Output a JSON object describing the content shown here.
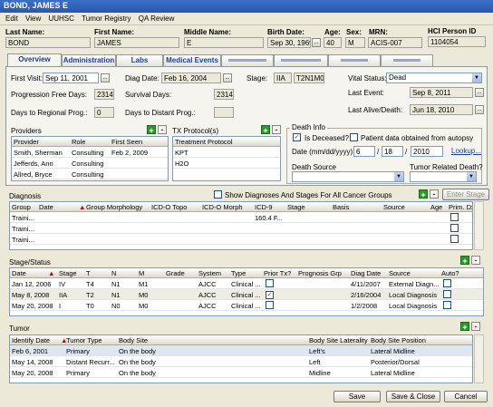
{
  "window": {
    "title": "BOND, JAMES E"
  },
  "menu": [
    "Edit",
    "View",
    "UUHSC",
    "Tumor Registry",
    "QA Review"
  ],
  "header": {
    "last_name_label": "Last Name:",
    "last_name": "BOND",
    "first_name_label": "First Name:",
    "first_name": "JAMES",
    "middle_name_label": "Middle Name:",
    "middle_name": "E",
    "birth_date_label": "Birth Date:",
    "birth_date": "Sep 30, 1969",
    "age_label": "Age:",
    "age": "40",
    "sex_label": "Sex:",
    "sex": "M",
    "mrn_label": "MRN:",
    "mrn": "ACIS-007",
    "hci_label": "HCI Person ID",
    "hci": "1104054"
  },
  "tabs": [
    "Overview",
    "Administration",
    "Labs",
    "Medical Events",
    "",
    "",
    "",
    ""
  ],
  "overview": {
    "first_visit_label": "First Visit:",
    "first_visit": "Sep 11, 2001",
    "diag_date_label": "Diag Date:",
    "diag_date": "Feb 16, 2004",
    "stage_label": "Stage:",
    "stage": "IIA",
    "stage_tnm": "T2N1M0",
    "vital_label": "Vital Status:",
    "vital": "Dead",
    "pfd_label": "Progression Free Days:",
    "pfd": "2314",
    "survival_label": "Survival Days:",
    "survival": "2314",
    "last_event_label": "Last Event:",
    "last_event": "Sep 8, 2011",
    "regional_label": "Days to Regional Prog.:",
    "regional": "0",
    "distant_label": "Days to Distant Prog.:",
    "distant": "",
    "last_alive_label": "Last Alive/Death:",
    "last_alive": "Jun 18, 2010"
  },
  "providers": {
    "title": "Providers",
    "columns": [
      "Provider",
      "Role",
      "First Seen"
    ],
    "rows": [
      [
        "Smith, Sherman",
        "Consulting",
        "Feb 2, 2009"
      ],
      [
        "Jefferds, Ann",
        "Consulting",
        ""
      ],
      [
        "Allred, Bryce",
        "Consulting",
        ""
      ]
    ]
  },
  "tx_protocols": {
    "title": "TX Protocol(s)",
    "column": "Treatment Protocol",
    "rows": [
      "KPT",
      "H2O"
    ]
  },
  "death_info": {
    "title": "Death Info",
    "is_deceased": "Is Deceased?",
    "autopsy": "Patient data obtained from autopsy",
    "date_label": "Date (mm/dd/yyyy)",
    "month": "6",
    "day": "18",
    "year": "2010",
    "lookup": "Lookup...",
    "source_label": "Death Source",
    "tumor_related_label": "Tumor Related Death?"
  },
  "diagnosis": {
    "title": "Diagnosis",
    "show_all": "Show Diagnoses And Stages For All Cancer Groups",
    "enter_stage": "Enter Stage",
    "columns": [
      "Group",
      "Date",
      "Group Morphology",
      "ICD-O Topo",
      "ICD-O Morph",
      "ICD-9",
      "Stage",
      "Basis",
      "Source",
      "Age",
      "Prim. Dx"
    ],
    "rows": [
      [
        "Traini...",
        "",
        "",
        "",
        "",
        "160.4 F...",
        "",
        "",
        "",
        "",
        ""
      ],
      [
        "Traini...",
        "",
        "",
        "",
        "",
        "",
        "",
        "",
        "",
        "",
        ""
      ],
      [
        "Traini...",
        "",
        "",
        "",
        "",
        "",
        "",
        "",
        "",
        "",
        ""
      ]
    ]
  },
  "stage_status": {
    "title": "Stage/Status",
    "columns": [
      "Date",
      "Stage",
      "T",
      "N",
      "M",
      "Grade",
      "System",
      "Type",
      "Prior Tx?",
      "Prognosis Grp",
      "Diag Date",
      "Source",
      "Auto?"
    ],
    "rows": [
      [
        "Jan 12, 2006",
        "IV",
        "T4",
        "N1",
        "M1",
        "",
        "AJCC",
        "Clinical ...",
        "",
        "",
        "4/11/2007",
        "External Diagn...",
        ""
      ],
      [
        "May 8, 2008",
        "IIA",
        "T2",
        "N1",
        "M0",
        "",
        "AJCC",
        "Clinical ...",
        "✓",
        "",
        "2/16/2004",
        "Local Diagnosis",
        ""
      ],
      [
        "May 20, 2008",
        "I",
        "T0",
        "N0",
        "M0",
        "",
        "AJCC",
        "Clinical ...",
        "",
        "",
        "1/2/2008",
        "Local Diagnosis",
        ""
      ]
    ]
  },
  "tumor": {
    "title": "Tumor",
    "columns": [
      "Identify Date",
      "Tumor Type",
      "Body Site",
      "Body Site Laterality",
      "Body Site Position"
    ],
    "rows": [
      [
        "Feb 6, 2001",
        "Primary",
        "On the body",
        "Left's",
        "Lateral Midline"
      ],
      [
        "May 14, 2008",
        "Distant Recurr...",
        "On the body",
        "Left",
        "Posterior/Dorsal"
      ],
      [
        "May 20, 2008",
        "Primary",
        "On the body",
        "Midline",
        "Lateral Midline"
      ]
    ]
  },
  "footer": {
    "save": "Save",
    "save_close": "Save & Close",
    "cancel": "Cancel"
  }
}
